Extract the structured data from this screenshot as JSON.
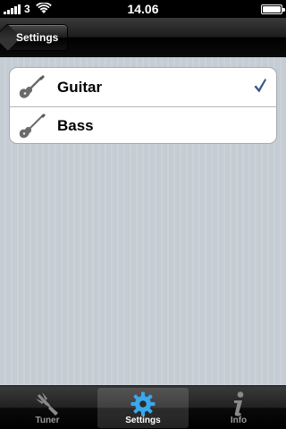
{
  "status_bar": {
    "carrier": "3",
    "time": "14.06"
  },
  "nav": {
    "back_label": "Settings"
  },
  "instruments": {
    "items": [
      {
        "label": "Guitar",
        "icon": "guitar-icon",
        "selected": true
      },
      {
        "label": "Bass",
        "icon": "bass-icon",
        "selected": false
      }
    ]
  },
  "tab_bar": {
    "items": [
      {
        "label": "Tuner",
        "icon": "tuning-fork-icon",
        "selected": false
      },
      {
        "label": "Settings",
        "icon": "gear-icon",
        "selected": true
      },
      {
        "label": "Info",
        "icon": "info-icon",
        "selected": false
      }
    ]
  },
  "colors": {
    "checkmark": "#385487",
    "background": "#c5ccd4",
    "tab_selected_icon": "#3aa8ec"
  }
}
